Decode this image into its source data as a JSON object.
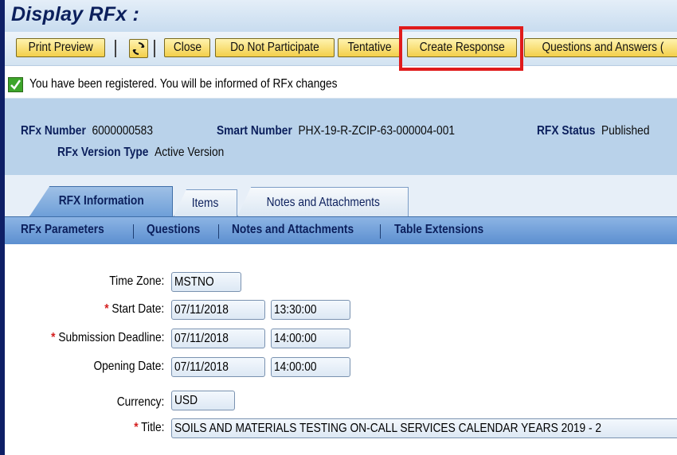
{
  "window": {
    "title": "Display RFx :"
  },
  "toolbar": {
    "print_preview": "Print Preview",
    "close": "Close",
    "do_not_participate": "Do Not Participate",
    "tentative": "Tentative",
    "create_response": "Create Response",
    "questions_answers": "Questions and Answers (",
    "refresh_icon": "refresh-icon"
  },
  "message": {
    "text": "You have been registered. You will be informed of RFx changes",
    "icon": "success-check-icon"
  },
  "header": {
    "rfx_number_label": "RFx Number",
    "rfx_number_value": "6000000583",
    "smart_number_label": "Smart Number",
    "smart_number_value": "PHX-19-R-ZCIP-63-000004-001",
    "status_label": "RFX Status",
    "status_value": "Published",
    "version_type_label": "RFx Version Type",
    "version_type_value": "Active Version"
  },
  "tabs": [
    {
      "label": "RFX Information"
    },
    {
      "label": "Items"
    },
    {
      "label": "Notes and Attachments"
    }
  ],
  "subtabs": [
    {
      "label": "RFx Parameters"
    },
    {
      "label": "Questions"
    },
    {
      "label": "Notes and Attachments"
    },
    {
      "label": "Table Extensions"
    }
  ],
  "form": {
    "required_marker": "*",
    "time_zone_label": "Time Zone:",
    "time_zone_value": "MSTNO",
    "start_date_label": "Start Date:",
    "start_date_value": "07/11/2018",
    "start_time_value": "13:30:00",
    "deadline_label": "Submission Deadline:",
    "deadline_date_value": "07/11/2018",
    "deadline_time_value": "14:00:00",
    "opening_label": "Opening Date:",
    "opening_date_value": "07/11/2018",
    "opening_time_value": "14:00:00",
    "currency_label": "Currency:",
    "currency_value": "USD",
    "title_label": "Title:",
    "title_value": "SOILS AND MATERIALS TESTING ON-CALL SERVICES CALENDAR YEARS 2019 - 2"
  },
  "colors": {
    "highlight": "#e01b1b",
    "button": "#f3cf4a",
    "header_bg": "#b9d2ea"
  }
}
